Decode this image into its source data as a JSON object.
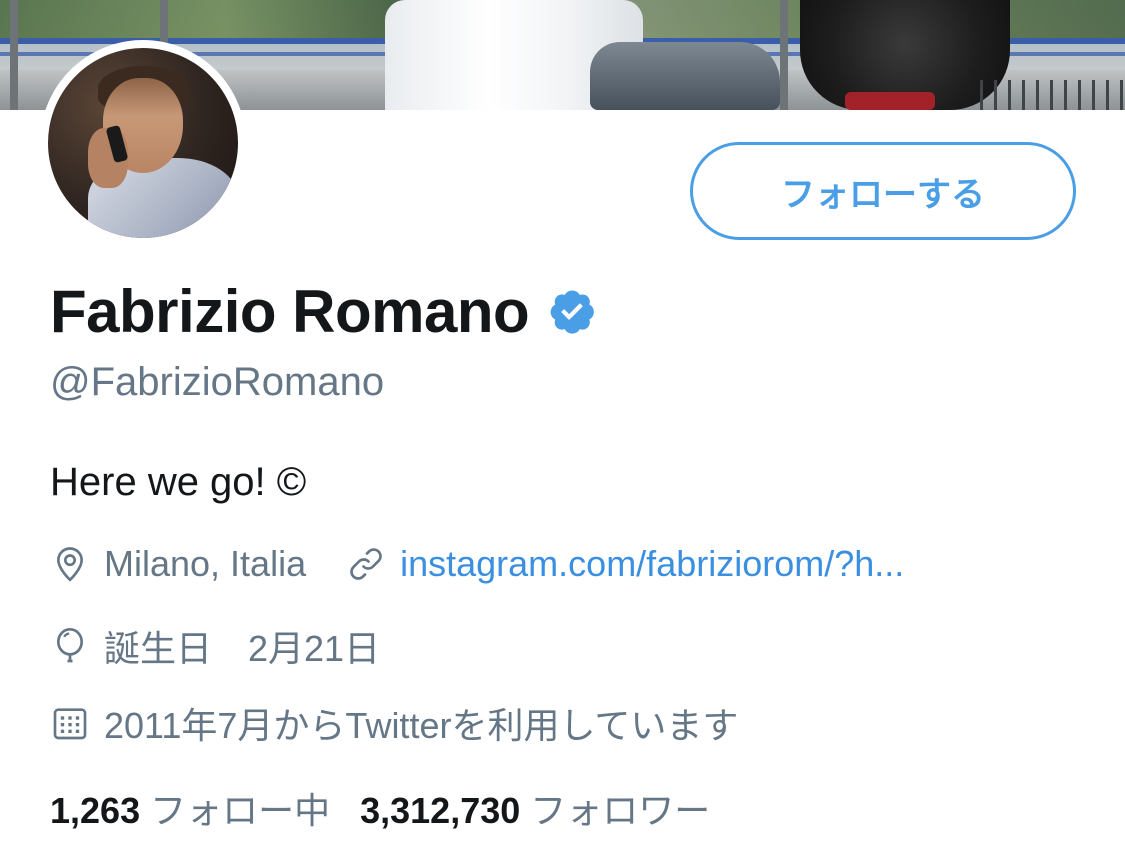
{
  "profile": {
    "name": "Fabrizio Romano",
    "handle": "@FabrizioRomano",
    "bio": "Here we go! ©",
    "verified": true,
    "location": "Milano, Italia",
    "website": "instagram.com/fabriziorom/?h...",
    "birthday": "誕生日　2月21日",
    "joined": "2011年7月からTwitterを利用しています"
  },
  "actions": {
    "follow_label": "フォローする"
  },
  "stats": {
    "following_count": "1,263",
    "following_label": "フォロー中",
    "followers_count": "3,312,730",
    "followers_label": "フォロワー"
  },
  "icons": {
    "location": "location-pin-icon",
    "link": "link-icon",
    "birthday": "balloon-icon",
    "joined": "calendar-icon",
    "verified": "verified-badge-icon"
  },
  "colors": {
    "accent": "#4a9ee6",
    "link": "#3a8fe0",
    "text_primary": "#14171a",
    "text_secondary": "#657786"
  }
}
